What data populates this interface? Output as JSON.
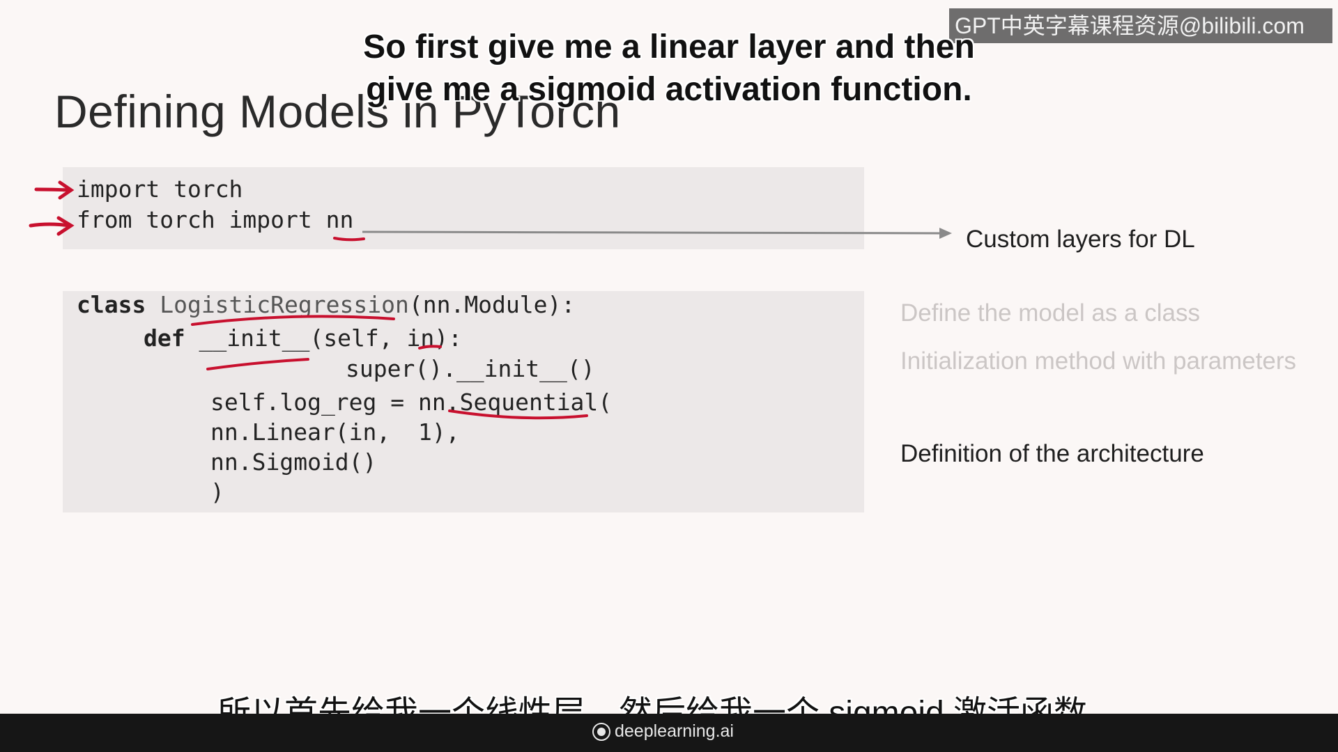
{
  "slide": {
    "title": "Defining Models in PyTorch",
    "imports": [
      {
        "kw": "import",
        "rest": " torch"
      },
      {
        "kw": "from",
        "rest": " torch import nn"
      }
    ],
    "class_code": {
      "line1_kw": "class",
      "line1_name": " LogisticRegression",
      "line1_rest": "(nn.Module):",
      "line2_kw": "def",
      "line2_rest": " __init__(self, in):",
      "line3": "super().__init__()",
      "line4": "self.log_reg = nn.Sequential(",
      "line5": "nn.Linear(in,  1),",
      "line6": "nn.Sigmoid()",
      "line7": ")"
    },
    "notes": {
      "custom_layers": "Custom layers for DL",
      "define_class": "Define the model as a class",
      "init_method": "Initialization method with parameters",
      "architecture": "Definition of the architecture"
    },
    "annotation_color": "#c8102e"
  },
  "subtitles": {
    "en_line1": "So first give me a linear layer and then",
    "en_line2": "give me a sigmoid activation function.",
    "cn": "所以首先给我一个线性层，然后给我一个 sigmoid 激活函数。"
  },
  "watermark": {
    "text": "GPT中英字幕课程资源@bilibili.com"
  },
  "footer": {
    "brand": "deeplearning.ai",
    "bar_color": "#161616"
  }
}
